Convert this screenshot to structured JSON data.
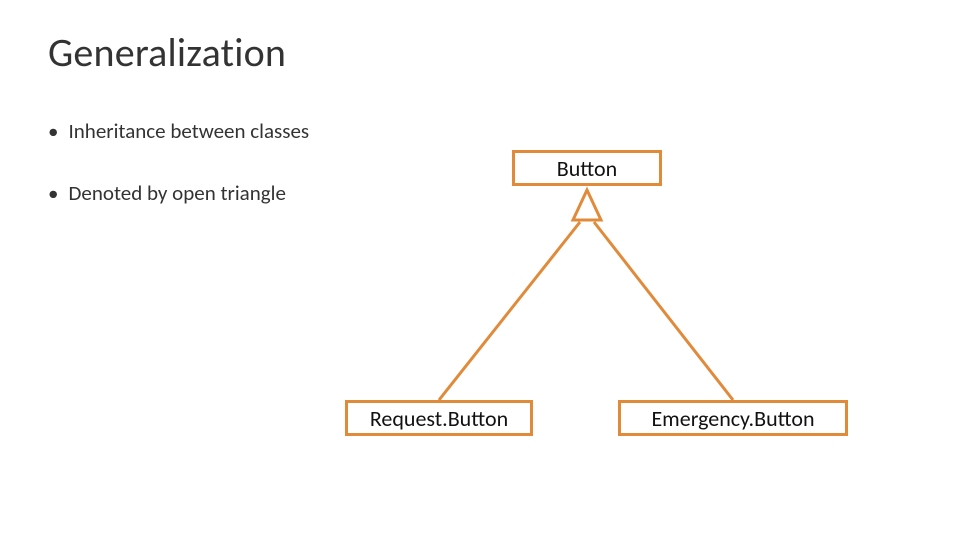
{
  "title": "Generalization",
  "bullets": [
    "Inheritance between classes",
    "Denoted by open triangle"
  ],
  "diagram": {
    "parent": "Button",
    "children": [
      "Request.Button",
      "Emergency.Button"
    ],
    "color": "#e08a3a"
  }
}
